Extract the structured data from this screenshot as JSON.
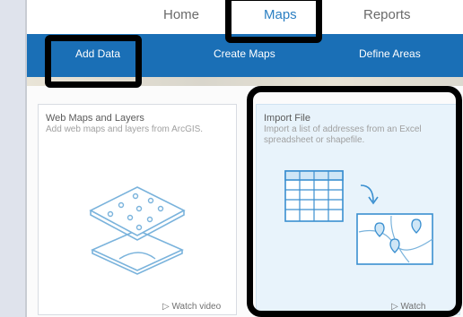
{
  "topnav": {
    "tabs": [
      {
        "label": "Home"
      },
      {
        "label": "Maps"
      },
      {
        "label": "Reports"
      }
    ]
  },
  "subnav": {
    "items": [
      {
        "label": "Add Data"
      },
      {
        "label": "Create Maps"
      },
      {
        "label": "Define Areas"
      }
    ]
  },
  "cards": {
    "web_maps": {
      "title": "Web Maps and Layers",
      "description": "Add web maps and layers from ArcGIS.",
      "watch_label": "Watch video"
    },
    "import_file": {
      "title": "Import File",
      "description": "Import a list of addresses from an Excel spreadsheet or shapefile.",
      "watch_label": "Watch"
    }
  },
  "colors": {
    "accent": "#1a6fb6",
    "active_tab": "#2b7fc2",
    "highlight": "#000000"
  }
}
